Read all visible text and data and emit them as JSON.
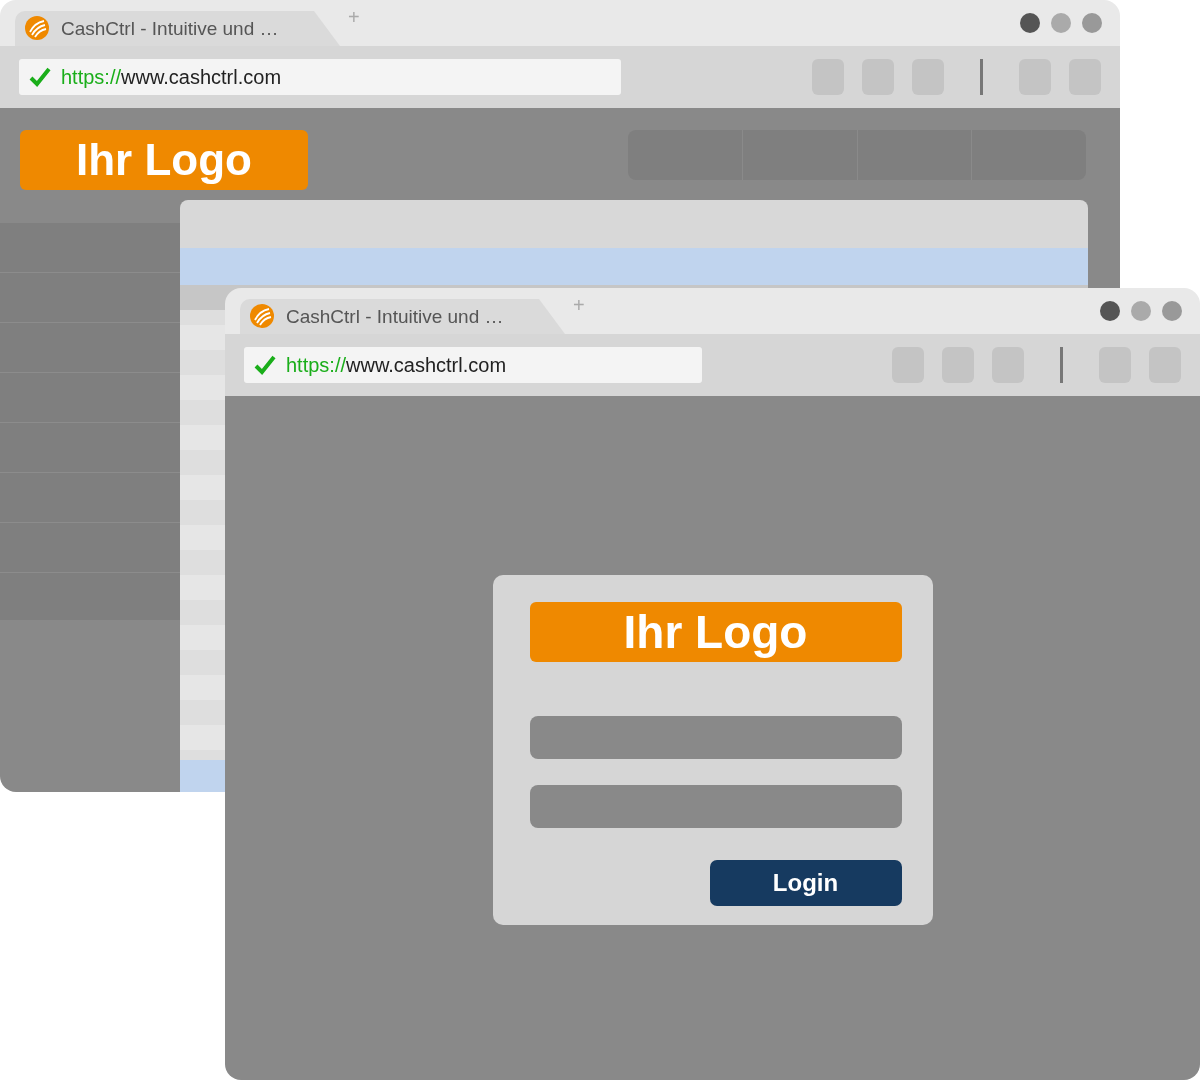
{
  "windows": [
    {
      "tab": {
        "title": "CashCtrl - Intuitive und …",
        "new_tab": "+"
      },
      "address": {
        "secure": true,
        "scheme": "https://",
        "host": "www.cashctrl.com"
      },
      "content": {
        "kind": "dashboard",
        "logo": "Ihr Logo"
      }
    },
    {
      "tab": {
        "title": "CashCtrl - Intuitive und …",
        "new_tab": "+"
      },
      "address": {
        "secure": true,
        "scheme": "https://",
        "host": "www.cashctrl.com"
      },
      "content": {
        "kind": "login",
        "logo": "Ihr Logo",
        "button": "Login"
      }
    }
  ]
}
